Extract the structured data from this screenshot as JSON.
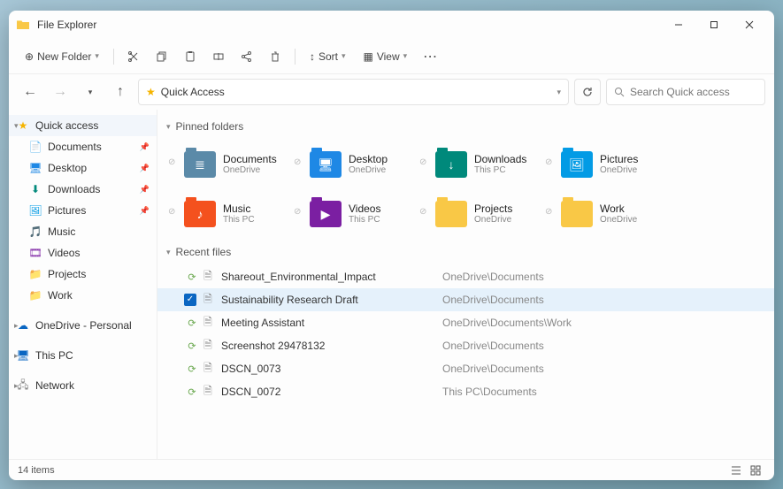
{
  "window": {
    "title": "File Explorer"
  },
  "toolbar": {
    "new_folder": "New Folder",
    "sort": "Sort",
    "view": "View"
  },
  "breadcrumb": {
    "label": "Quick Access"
  },
  "search": {
    "placeholder": "Search Quick access"
  },
  "sidebar": {
    "top": "Quick access",
    "items": [
      {
        "label": "Documents",
        "pinned": true
      },
      {
        "label": "Desktop",
        "pinned": true
      },
      {
        "label": "Downloads",
        "pinned": true
      },
      {
        "label": "Pictures",
        "pinned": true
      },
      {
        "label": "Music",
        "pinned": false
      },
      {
        "label": "Videos",
        "pinned": false
      },
      {
        "label": "Projects",
        "pinned": false
      },
      {
        "label": "Work",
        "pinned": false
      }
    ],
    "onedrive": "OneDrive - Personal",
    "thispc": "This PC",
    "network": "Network"
  },
  "pinned_header": "Pinned folders",
  "pinned": [
    {
      "name": "Documents",
      "loc": "OneDrive",
      "color": "#5b8aa8"
    },
    {
      "name": "Desktop",
      "loc": "OneDrive",
      "color": "#1e88e5"
    },
    {
      "name": "Downloads",
      "loc": "This PC",
      "color": "#00897b"
    },
    {
      "name": "Pictures",
      "loc": "OneDrive",
      "color": "#039be5"
    },
    {
      "name": "Music",
      "loc": "This PC",
      "color": "#f4511e"
    },
    {
      "name": "Videos",
      "loc": "This PC",
      "color": "#7b1fa2"
    },
    {
      "name": "Projects",
      "loc": "OneDrive",
      "color": "#f9c846"
    },
    {
      "name": "Work",
      "loc": "OneDrive",
      "color": "#f9c846"
    }
  ],
  "recent_header": "Recent files",
  "recent": [
    {
      "name": "Shareout_Environmental_Impact",
      "loc": "OneDrive\\Documents",
      "selected": false
    },
    {
      "name": "Sustainability Research Draft",
      "loc": "OneDrive\\Documents",
      "selected": true
    },
    {
      "name": "Meeting Assistant",
      "loc": "OneDrive\\Documents\\Work",
      "selected": false
    },
    {
      "name": "Screenshot 29478132",
      "loc": "OneDrive\\Documents",
      "selected": false
    },
    {
      "name": "DSCN_0073",
      "loc": "OneDrive\\Documents",
      "selected": false
    },
    {
      "name": "DSCN_0072",
      "loc": "This PC\\Documents",
      "selected": false
    }
  ],
  "status": {
    "count": "14 items"
  }
}
